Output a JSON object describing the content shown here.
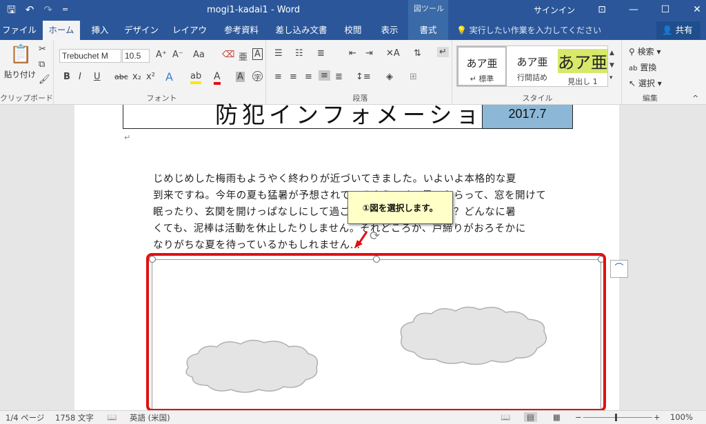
{
  "titlebar": {
    "doc_title": "mogi1-kadai1  -  Word",
    "context_group": "図ツール",
    "signin": "サインイン",
    "qat": {
      "save": "🖫",
      "undo": "↶",
      "redo": "↷",
      "customize": "="
    },
    "window_controls": {
      "ribbon_display": "⊡",
      "minimize": "—",
      "maximize": "☐",
      "close": "✕"
    }
  },
  "tabs": [
    {
      "label": "ファイル"
    },
    {
      "label": "ホーム"
    },
    {
      "label": "挿入"
    },
    {
      "label": "デザイン"
    },
    {
      "label": "レイアウト"
    },
    {
      "label": "参考資料"
    },
    {
      "label": "差し込み文書"
    },
    {
      "label": "校閲"
    },
    {
      "label": "表示"
    },
    {
      "label": "書式"
    }
  ],
  "tellme": "実行したい作業を入力してください",
  "share_label": "共有",
  "ribbon": {
    "clipboard": {
      "paste_label": "貼り付け",
      "group_label": "クリップボード"
    },
    "font": {
      "font_name": "Trebuchet M",
      "font_size": "10.5",
      "group_label": "フォント"
    },
    "paragraph": {
      "group_label": "段落"
    },
    "styles": {
      "group_label": "スタイル",
      "items": [
        {
          "preview": "あア亜",
          "name": "↵ 標準"
        },
        {
          "preview": "あア亜",
          "name": "行間詰め"
        },
        {
          "preview": "あア亜",
          "name": "見出し 1"
        }
      ]
    },
    "editing": {
      "find": "検索",
      "replace": "置換",
      "select": "選択",
      "group_label": "編集"
    }
  },
  "document": {
    "title": "防犯インフォメーション",
    "date": "2017.7",
    "body_lines": [
      "じめじめした梅雨もようやく終わりが近づいてきました。いよいよ本格的な夏",
      "到来ですね。今年の夏も猛暑が予想されているようです。暑いからって、窓を開けて",
      "眠ったり、玄関を開けっぱなしにして過ごしたりしていませんか？どんなに暑",
      "くても、泥棒は活動を休止したりしません。それどころか、戸締りがおろそかに",
      "なりがちな夏を待っているかもしれません…"
    ],
    "callout": "①図を選択します。"
  },
  "status": {
    "page": "1/4 ページ",
    "words": "1758 文字",
    "language": "英語 (米国)",
    "zoom": "100%"
  }
}
